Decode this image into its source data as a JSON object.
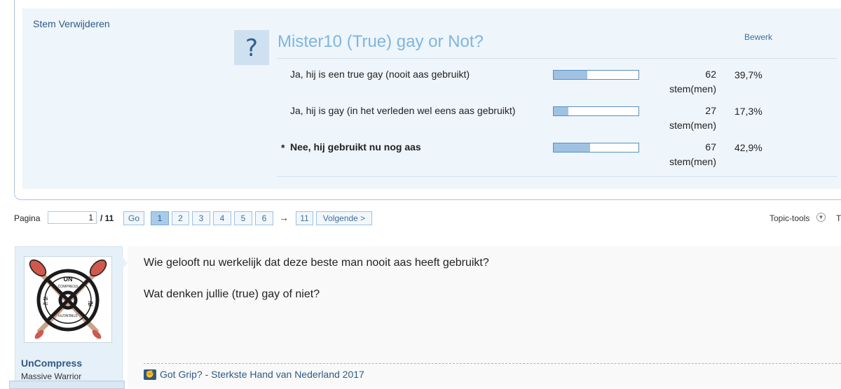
{
  "poll": {
    "delete_vote": "Stem Verwijderen",
    "question_icon": "?",
    "title": "Mister10 (True) gay or Not?",
    "edit_label": "Bewerk",
    "options": [
      {
        "label": "Ja, hij is een true gay (nooit aas gebruikt)",
        "count": "62",
        "unit": "stem(men)",
        "percent": "39,7%",
        "fraction": 0.397,
        "selected": false
      },
      {
        "label": "Ja, hij is gay (in het verleden wel eens aas gebruikt)",
        "count": "27",
        "unit": "stem(men)",
        "percent": "17,3%",
        "fraction": 0.173,
        "selected": false
      },
      {
        "label": "Nee, hij gebruikt nu nog aas",
        "count": "67",
        "unit": "stem(men)",
        "percent": "42,9%",
        "fraction": 0.429,
        "selected": true,
        "marker": "*"
      }
    ]
  },
  "pagination": {
    "label": "Pagina",
    "current_value": "1",
    "total": "/ 11",
    "go_label": "Go",
    "pages": [
      "1",
      "2",
      "3",
      "4",
      "5",
      "6"
    ],
    "active_page": "1",
    "arrow": "→",
    "last_page": "11",
    "next_label": "Volgende >"
  },
  "topic_tools": {
    "label": "Topic-tools",
    "icon": "chevron-down-icon",
    "trailing": "T"
  },
  "post": {
    "username": "UnCompress",
    "rank": "Massive Warrior",
    "avatar": {
      "top": "UN",
      "middle": "COMPRESS",
      "left_weight": "25",
      "left_unit": "KG",
      "right_weight": "25",
      "right_unit": "KG",
      "bottom": "STRENGTH"
    },
    "line1": "Wie gelooft nu werkelijk dat deze beste man nooit aas heeft gebruikt?",
    "line2": "Wat denken jullie (true) gay of niet?",
    "signature": "Got Grip? - Sterkste Hand van Nederland 2017",
    "signature_icon": "grip-icon"
  },
  "colors": {
    "link": "#2e5a84",
    "poll_title": "#7eb6e0",
    "poll_bg": "#eef5fb",
    "bar_fill": "#9fc2e3",
    "bar_border": "#5a8fc1",
    "user_card": "#e6f0f8"
  }
}
